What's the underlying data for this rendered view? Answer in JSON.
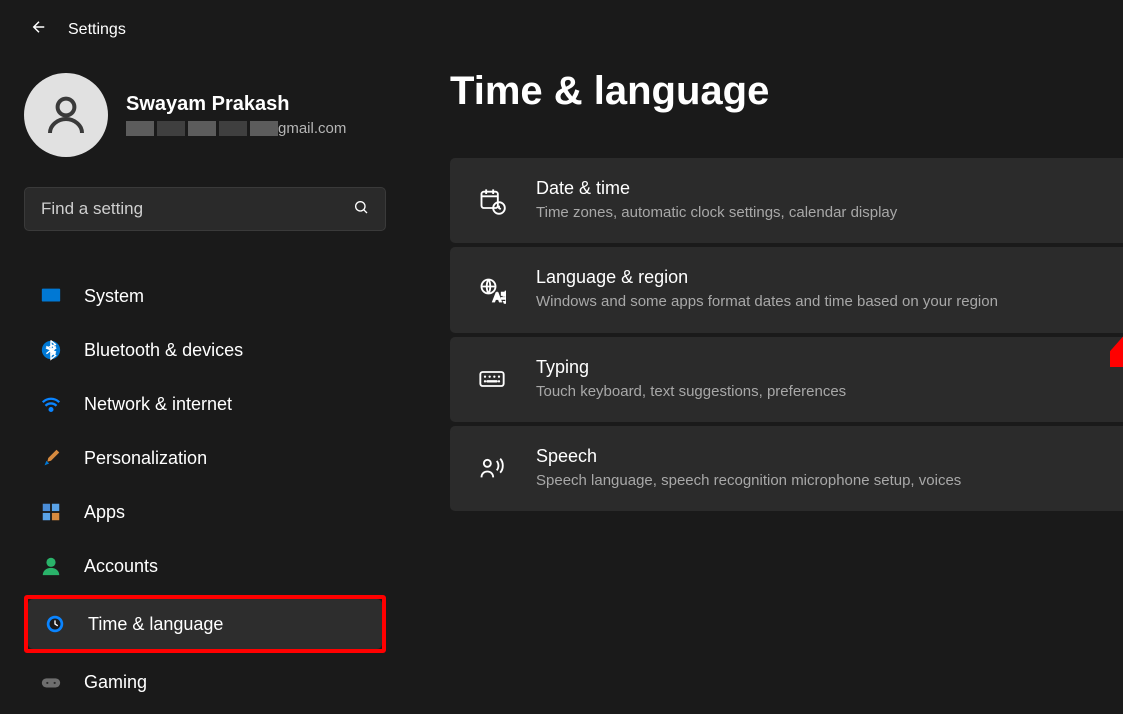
{
  "header": {
    "app_title": "Settings"
  },
  "profile": {
    "name": "Swayam Prakash",
    "email_suffix": "gmail.com"
  },
  "search": {
    "placeholder": "Find a setting"
  },
  "sidebar": {
    "items": [
      {
        "label": "System",
        "icon": "monitor-icon",
        "active": false
      },
      {
        "label": "Bluetooth & devices",
        "icon": "bluetooth-icon",
        "active": false
      },
      {
        "label": "Network & internet",
        "icon": "wifi-icon",
        "active": false
      },
      {
        "label": "Personalization",
        "icon": "brush-icon",
        "active": false
      },
      {
        "label": "Apps",
        "icon": "apps-icon",
        "active": false
      },
      {
        "label": "Accounts",
        "icon": "person-icon",
        "active": false
      },
      {
        "label": "Time & language",
        "icon": "clock-globe-icon",
        "active": true
      },
      {
        "label": "Gaming",
        "icon": "gamepad-icon",
        "active": false
      }
    ]
  },
  "main": {
    "title": "Time & language",
    "cards": [
      {
        "title": "Date & time",
        "desc": "Time zones, automatic clock settings, calendar display",
        "icon": "calendar-clock-icon"
      },
      {
        "title": "Language & region",
        "desc": "Windows and some apps format dates and time based on your region",
        "icon": "globe-translate-icon"
      },
      {
        "title": "Typing",
        "desc": "Touch keyboard, text suggestions, preferences",
        "icon": "keyboard-icon"
      },
      {
        "title": "Speech",
        "desc": "Speech language, speech recognition microphone setup, voices",
        "icon": "speech-icon"
      }
    ]
  },
  "annotation": {
    "highlighted_sidebar_index": 6,
    "arrow_target": "Language & region"
  }
}
